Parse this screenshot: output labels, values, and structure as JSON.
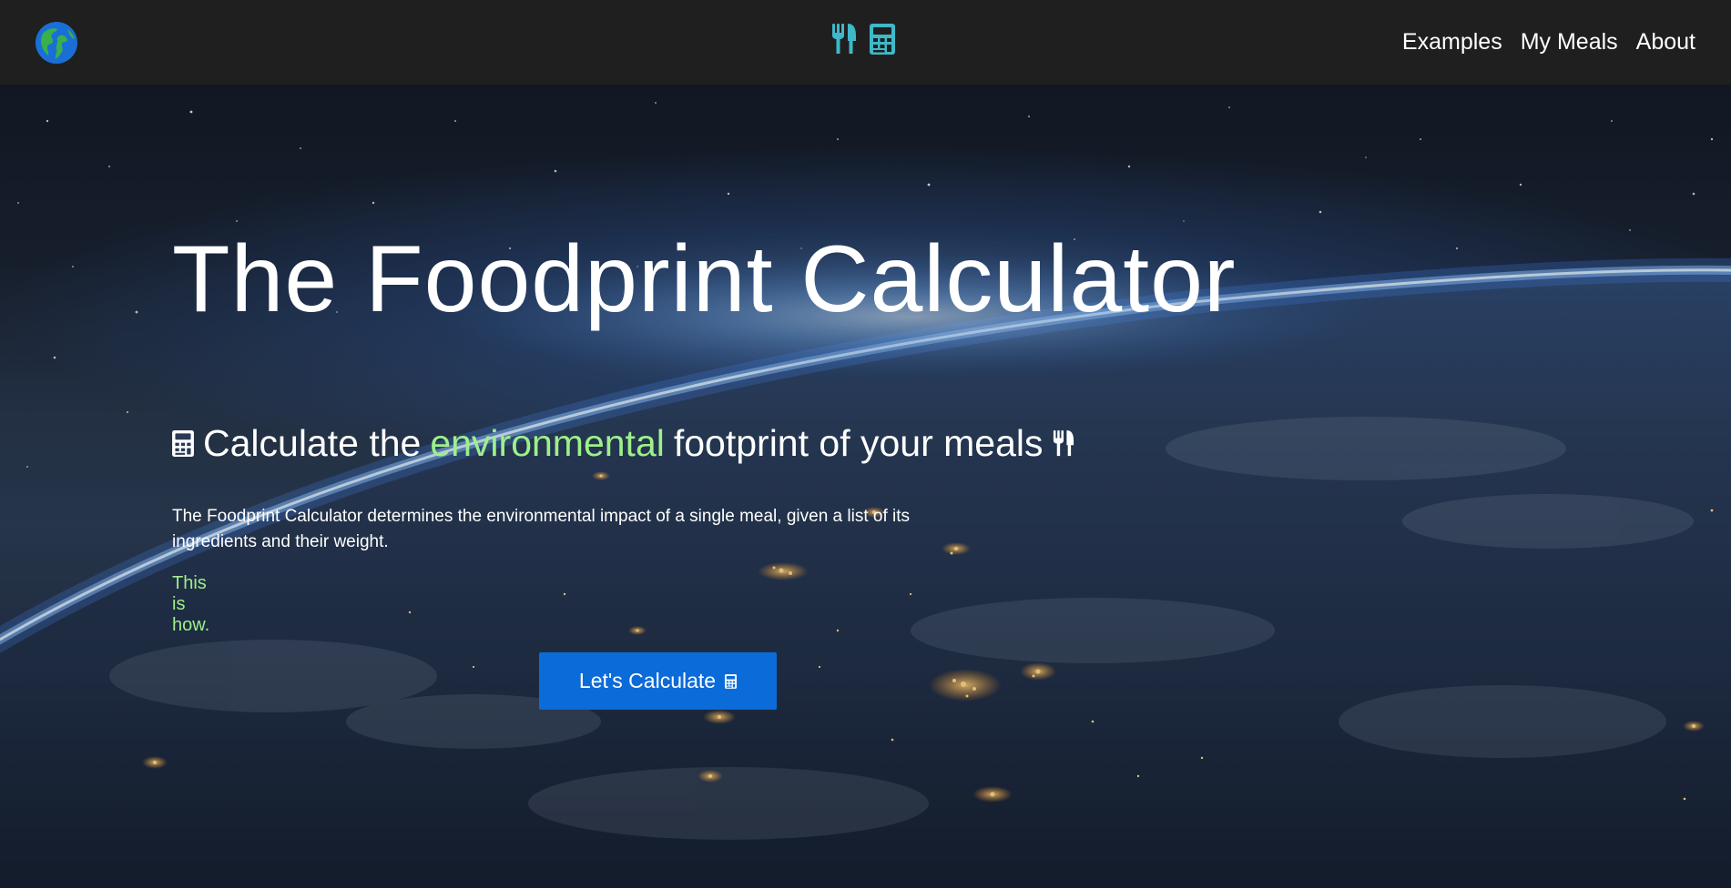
{
  "navbar": {
    "logo_icon": "globe-americas-icon",
    "center_icons": [
      "utensils-icon",
      "calculator-icon"
    ],
    "center_icon_color": "#3fb8c9",
    "links": [
      {
        "label": "Examples"
      },
      {
        "label": "My Meals"
      },
      {
        "label": "About"
      }
    ]
  },
  "hero": {
    "background": "night-earth-from-space",
    "title": "The Foodprint Calculator",
    "subtitle": {
      "before": "Calculate the",
      "highlight": "environmental",
      "after": "footprint of your meals",
      "leading_icon": "calculator-icon",
      "trailing_icon": "utensils-icon",
      "highlight_color": "#9ef08a"
    },
    "description": "The Foodprint Calculator determines the environmental impact of a single meal, given a list of its ingredients and their weight.",
    "how_link": "This is how.",
    "cta": {
      "label": "Let's Calculate",
      "icon": "calculator-icon",
      "color": "#0b6bd8"
    }
  }
}
